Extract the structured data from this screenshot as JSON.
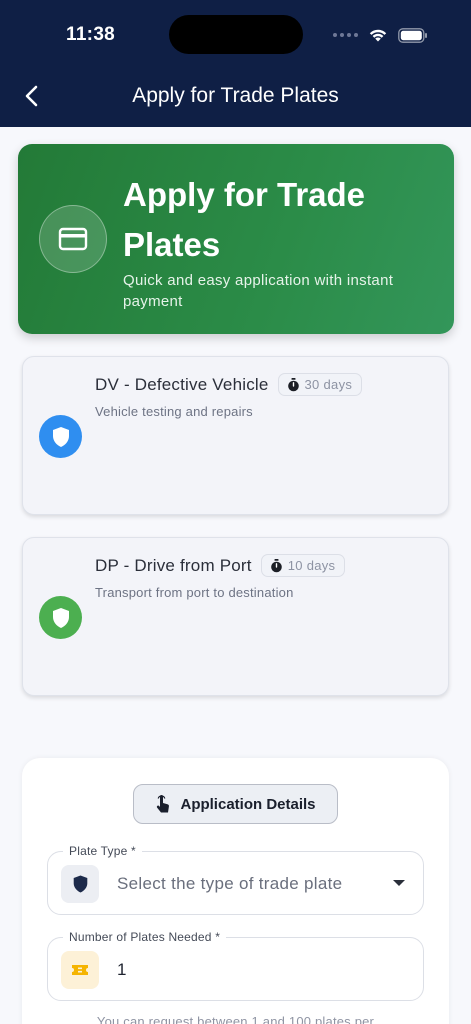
{
  "status_bar": {
    "time": "11:38"
  },
  "nav": {
    "title": "Apply for Trade Plates"
  },
  "hero": {
    "title": "Apply for Trade Plates",
    "subtitle": "Quick and easy application with instant payment"
  },
  "plates": [
    {
      "title": "DV - Defective Vehicle",
      "duration": "30 days",
      "description": "Vehicle testing and repairs",
      "badge_color": "#2f8ef0"
    },
    {
      "title": "DP - Drive from Port",
      "duration": "10 days",
      "description": "Transport from port to destination",
      "badge_color": "#4caf50"
    }
  ],
  "form": {
    "section_label": "Application Details",
    "plate_type": {
      "label": "Plate Type *",
      "placeholder": "Select the type of trade plate"
    },
    "quantity": {
      "label": "Number of Plates Needed *",
      "value": "1"
    },
    "help_text": "You can request between 1 and 100 plates per"
  },
  "colors": {
    "header": "#0f1f45",
    "hero": "#2b8c48",
    "accent_blue": "#2f8ef0",
    "accent_green": "#4caf50"
  }
}
